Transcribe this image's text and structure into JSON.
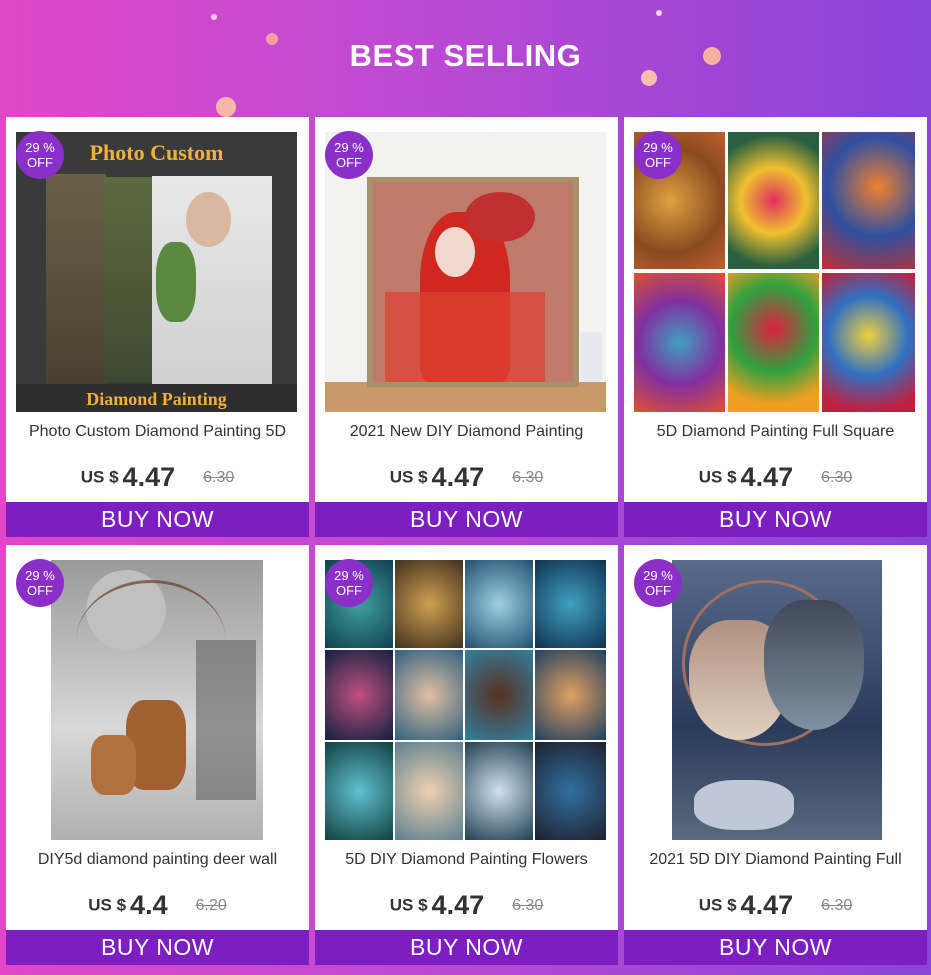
{
  "header": {
    "title": "BEST SELLING"
  },
  "colors": {
    "accent": "#7d1fc0",
    "badge": "#8b2fc9",
    "background_start": "#e048c8",
    "background_end": "#8a44d8"
  },
  "products": [
    {
      "badge_pct": "29 %",
      "badge_off": "OFF",
      "image_caption_top": "Photo Custom",
      "image_caption_bottom": "Diamond Painting",
      "name": "Photo Custom Diamond Painting 5D",
      "currency": "US $",
      "price": "4.47",
      "old_price": "6.30",
      "buy_label": "BUY NOW"
    },
    {
      "badge_pct": "29 %",
      "badge_off": "OFF",
      "name": "2021 New DIY  Diamond Painting",
      "currency": "US $",
      "price": "4.47",
      "old_price": "6.30",
      "buy_label": "BUY NOW"
    },
    {
      "badge_pct": "29 %",
      "badge_off": "OFF",
      "name": "5D  Diamond Painting Full Square",
      "currency": "US $",
      "price": "4.47",
      "old_price": "6.30",
      "buy_label": "BUY NOW"
    },
    {
      "badge_pct": "29 %",
      "badge_off": "OFF",
      "name": "DIY5d  diamond painting   deer wall",
      "currency": "US $",
      "price": "4.4",
      "old_price": "6.20",
      "buy_label": "BUY NOW"
    },
    {
      "badge_pct": "29 %",
      "badge_off": "OFF",
      "name": "5D DIY  Diamond Painting Flowers",
      "currency": "US $",
      "price": "4.47",
      "old_price": "6.30",
      "buy_label": "BUY NOW"
    },
    {
      "badge_pct": "29 %",
      "badge_off": "OFF",
      "name": "2021 5D DIY  Diamond Painting Full",
      "currency": "US $",
      "price": "4.47",
      "old_price": "6.30",
      "buy_label": "BUY NOW"
    }
  ]
}
